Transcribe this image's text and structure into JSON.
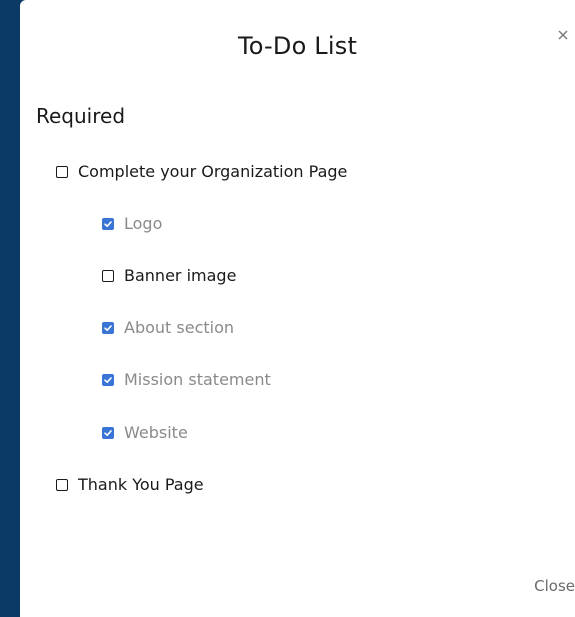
{
  "modal": {
    "title": "To-Do List",
    "close_icon": "close-icon",
    "close_label": "Close"
  },
  "section": {
    "heading": "Required"
  },
  "items": [
    {
      "label": "Complete your Organization Page",
      "checked": false,
      "level": "parent"
    },
    {
      "label": "Logo",
      "checked": true,
      "level": "child"
    },
    {
      "label": "Banner image",
      "checked": false,
      "level": "child"
    },
    {
      "label": "About section",
      "checked": true,
      "level": "child"
    },
    {
      "label": "Mission statement",
      "checked": true,
      "level": "child"
    },
    {
      "label": "Website",
      "checked": true,
      "level": "child"
    },
    {
      "label": "Thank You Page",
      "checked": false,
      "level": "parent"
    }
  ],
  "colors": {
    "backdrop": "#0b3a66",
    "checkbox_checked": "#3a75d6",
    "completed_text": "#8a8a8a"
  }
}
